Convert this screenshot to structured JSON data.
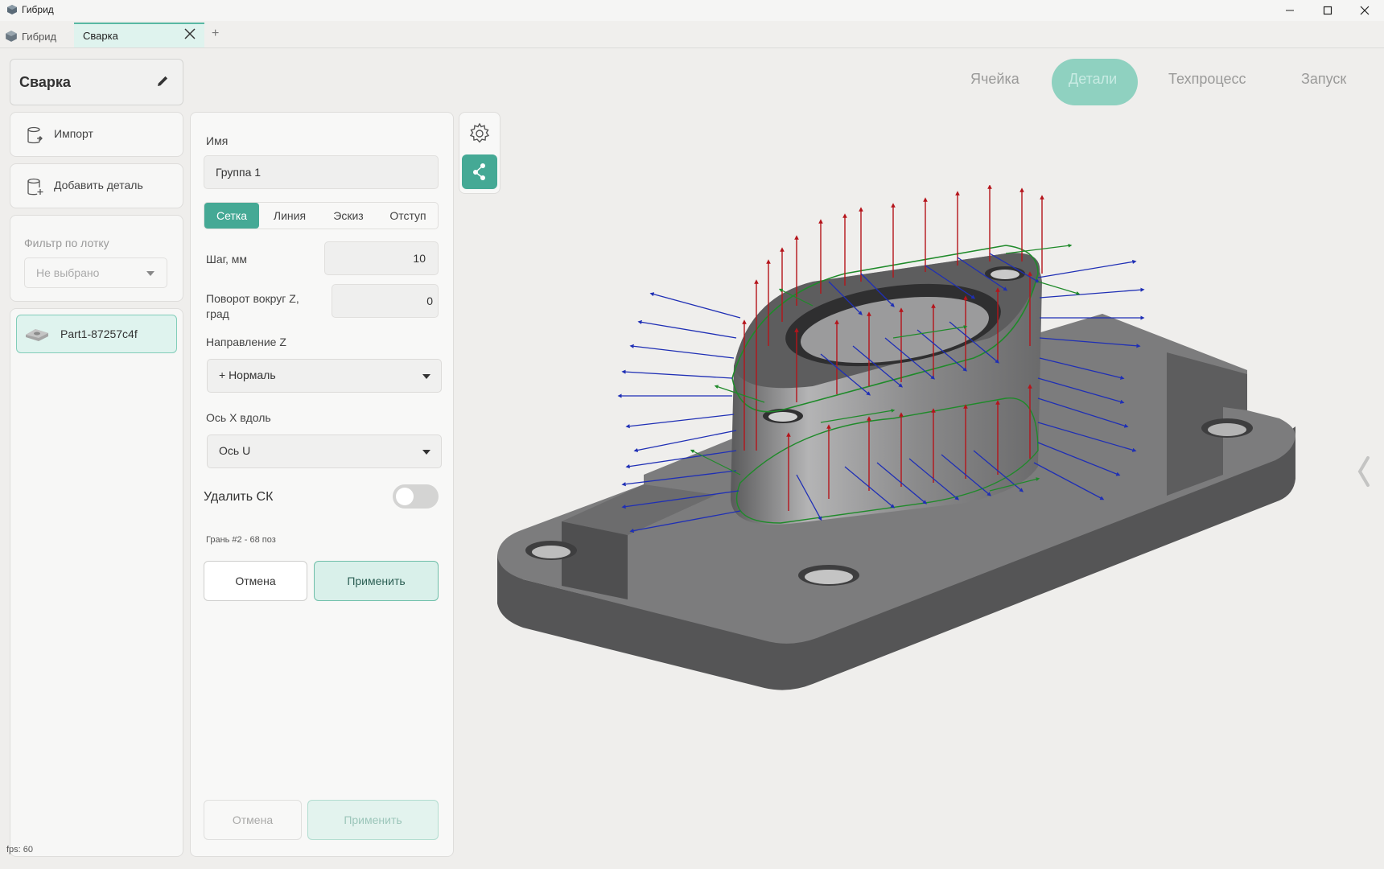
{
  "window": {
    "title": "Гибрид",
    "controls": [
      "minimize",
      "maximize",
      "close"
    ]
  },
  "tabs": {
    "home_label": "Гибрид",
    "active_label": "Сварка",
    "add_label": "+"
  },
  "project": {
    "name": "Сварка"
  },
  "sidebar": {
    "import_label": "Импорт",
    "add_part_label": "Добавить деталь",
    "filter_label": "Фильтр по лотку",
    "filter_value": "Не выбрано",
    "parts": [
      {
        "label": "Part1-87257c4f",
        "selected": true
      }
    ]
  },
  "form": {
    "name_label": "Имя",
    "name_value": "Группа 1",
    "mode_tabs": [
      {
        "label": "Сетка",
        "active": true
      },
      {
        "label": "Линия",
        "active": false
      },
      {
        "label": "Эскиз",
        "active": false
      },
      {
        "label": "Отступ",
        "active": false
      }
    ],
    "step_label": "Шаг, мм",
    "step_value": "10",
    "rotation_label": "Поворот вокруг Z, град",
    "rotation_value": "0",
    "dir_z_label": "Направление Z",
    "dir_z_value": "+ Нормаль",
    "axis_x_label": "Ось X вдоль",
    "axis_x_value": "Ось U",
    "delete_cs_label": "Удалить СК",
    "delete_cs_enabled": false,
    "face_info": "Грань #2 - 68 поз",
    "cancel_label": "Отмена",
    "apply_label": "Применить",
    "cancel_label_2": "Отмена",
    "apply_label_2": "Применить"
  },
  "nav": {
    "items": [
      {
        "label": "Ячейка",
        "active": false
      },
      {
        "label": "Детали",
        "active": true
      },
      {
        "label": "Техпроцесс",
        "active": false
      },
      {
        "label": "Запуск",
        "active": false
      }
    ]
  },
  "toolbar": {
    "icons": [
      "gear-icon",
      "share-icon"
    ]
  },
  "status": {
    "fps": "fps: 60"
  },
  "colors": {
    "accent": "#45a995",
    "accent_light": "#dff3ee",
    "arrow_normal": "#b5141b",
    "arrow_x": "#1f2fb5",
    "arrow_y": "#1f8a2a",
    "model": "#6f6f70"
  }
}
